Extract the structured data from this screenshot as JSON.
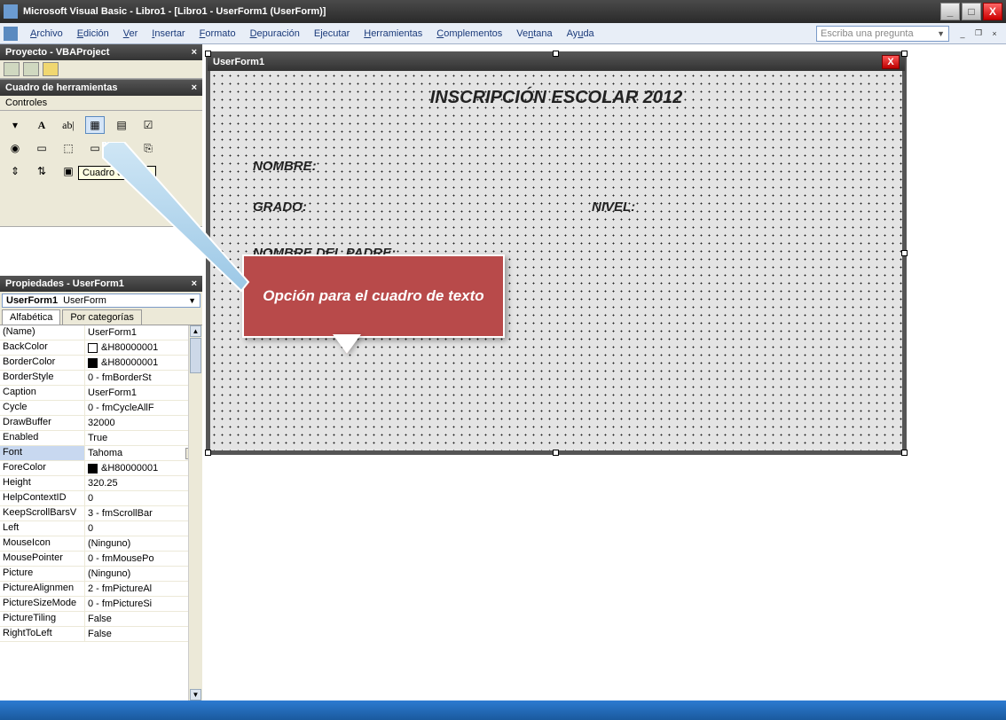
{
  "titlebar": {
    "title": "Microsoft Visual Basic - Libro1 - [Libro1 - UserForm1 (UserForm)]"
  },
  "menu": {
    "items": [
      "Archivo",
      "Edición",
      "Ver",
      "Insertar",
      "Formato",
      "Depuración",
      "Ejecutar",
      "Herramientas",
      "Complementos",
      "Ventana",
      "Ayuda"
    ],
    "helpPlaceholder": "Escriba una pregunta"
  },
  "project": {
    "title": "Proyecto - VBAProject"
  },
  "toolbox": {
    "title": "Cuadro de herramientas",
    "tab": "Controles",
    "tooltip": "Cuadro de texto"
  },
  "callout": {
    "text": "Opción para el cuadro de texto"
  },
  "properties": {
    "title": "Propiedades - UserForm1",
    "objectName": "UserForm1",
    "objectType": "UserForm",
    "tabs": [
      "Alfabética",
      "Por categorías"
    ],
    "rows": [
      {
        "name": "(Name)",
        "value": "UserForm1"
      },
      {
        "name": "BackColor",
        "value": "&H80000001",
        "swatch": "white"
      },
      {
        "name": "BorderColor",
        "value": "&H80000001",
        "swatch": "black"
      },
      {
        "name": "BorderStyle",
        "value": "0 - fmBorderSt"
      },
      {
        "name": "Caption",
        "value": "UserForm1"
      },
      {
        "name": "Cycle",
        "value": "0 - fmCycleAllF"
      },
      {
        "name": "DrawBuffer",
        "value": "32000"
      },
      {
        "name": "Enabled",
        "value": "True"
      },
      {
        "name": "Font",
        "value": "Tahoma",
        "selected": true,
        "ellipsis": true
      },
      {
        "name": "ForeColor",
        "value": "&H80000001",
        "swatch": "black"
      },
      {
        "name": "Height",
        "value": "320.25"
      },
      {
        "name": "HelpContextID",
        "value": "0"
      },
      {
        "name": "KeepScrollBarsV",
        "value": "3 - fmScrollBar"
      },
      {
        "name": "Left",
        "value": "0"
      },
      {
        "name": "MouseIcon",
        "value": "(Ninguno)"
      },
      {
        "name": "MousePointer",
        "value": "0 - fmMousePo"
      },
      {
        "name": "Picture",
        "value": "(Ninguno)"
      },
      {
        "name": "PictureAlignmen",
        "value": "2 - fmPictureAl"
      },
      {
        "name": "PictureSizeMode",
        "value": "0 - fmPictureSi"
      },
      {
        "name": "PictureTiling",
        "value": "False"
      },
      {
        "name": "RightToLeft",
        "value": "False"
      }
    ]
  },
  "form": {
    "caption": "UserForm1",
    "title": "INSCRIPCIÓN ESCOLAR 2012",
    "labels": {
      "nombre": "NOMBRE:",
      "grado": "GRADO:",
      "nivel": "NIVEL:",
      "padre": "NOMBRE DEL PADRE:"
    }
  }
}
